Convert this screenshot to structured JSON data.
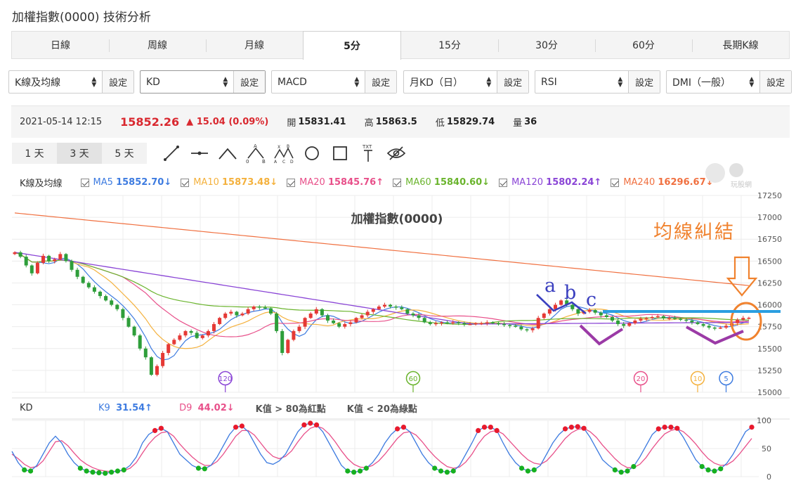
{
  "page": {
    "title": "加權指數(0000) 技術分析"
  },
  "tabs": [
    {
      "label": "日線",
      "active": false
    },
    {
      "label": "周線",
      "active": false
    },
    {
      "label": "月線",
      "active": false
    },
    {
      "label": "5分",
      "active": true
    },
    {
      "label": "15分",
      "active": false
    },
    {
      "label": "30分",
      "active": false
    },
    {
      "label": "60分",
      "active": false
    },
    {
      "label": "長期K線",
      "active": false
    }
  ],
  "selectors": [
    {
      "value": "K線及均線",
      "button": "設定"
    },
    {
      "value": "KD",
      "button": "設定"
    },
    {
      "value": "MACD",
      "button": "設定"
    },
    {
      "value": "月KD（日）",
      "button": "設定"
    },
    {
      "value": "RSI",
      "button": "設定"
    },
    {
      "value": "DMI（一般）",
      "button": "設定"
    }
  ],
  "quote": {
    "datetime": "2021-05-14 12:15",
    "price": "15852.26",
    "change": "▲ 15.04 (0.09%)",
    "open_label": "開",
    "open": "15831.41",
    "high_label": "高",
    "high": "15863.5",
    "low_label": "低",
    "low": "15829.74",
    "volume_label": "量",
    "volume": "36"
  },
  "ranges": [
    {
      "label": "1 天",
      "active": false
    },
    {
      "label": "3 天",
      "active": true
    },
    {
      "label": "5 天",
      "active": false
    }
  ],
  "drawing_tools": [
    "line-tool-icon",
    "horizontal-line-tool-icon",
    "angle-tool-icon",
    "abc-pattern-tool-icon",
    "abcd-pattern-tool-icon",
    "circle-tool-icon",
    "rectangle-tool-icon",
    "text-tool-icon",
    "hide-drawings-icon"
  ],
  "ma_legend": {
    "title": "K線及均線",
    "items": [
      {
        "name": "MA5",
        "value": "15852.70↓",
        "color": "#3d7be0"
      },
      {
        "name": "MA10",
        "value": "15873.48↓",
        "color": "#f4b13d"
      },
      {
        "name": "MA20",
        "value": "15845.76↑",
        "color": "#e8508a"
      },
      {
        "name": "MA60",
        "value": "15840.60↓",
        "color": "#6ab42d"
      },
      {
        "name": "MA120",
        "value": "15802.24↑",
        "color": "#8a45d6"
      },
      {
        "name": "MA240",
        "value": "16296.67↓",
        "color": "#f07040"
      }
    ]
  },
  "watermark": "玩股網",
  "chart_title": "加權指數(0000)",
  "annotations": {
    "text": "均線糾結",
    "letters": [
      "a",
      "b",
      "c"
    ]
  },
  "kd_legend": {
    "title": "KD",
    "k_label": "K9",
    "k_value": "31.54↑",
    "k_color": "#3d7be0",
    "d_label": "D9",
    "d_value": "44.02↓",
    "d_color": "#e8508a",
    "note1": "K值 > 80為紅點",
    "note2": "K值 < 20為綠點"
  },
  "chart_data": [
    {
      "type": "candlestick",
      "title": "加權指數(0000)",
      "y_ticks": [
        15000,
        15250,
        15500,
        15750,
        16000,
        16250,
        16500,
        16750,
        17000,
        17250
      ],
      "ylim": [
        15000,
        17250
      ],
      "grid": true,
      "ma_markers": [
        {
          "label": "120",
          "color": "#8a45d6"
        },
        {
          "label": "60",
          "color": "#6ab42d"
        },
        {
          "label": "20",
          "color": "#e8508a"
        },
        {
          "label": "10",
          "color": "#f4b13d"
        },
        {
          "label": "5",
          "color": "#3d7be0"
        }
      ],
      "closes": [
        16600,
        16550,
        16450,
        16360,
        16480,
        16560,
        16500,
        16520,
        16580,
        16500,
        16400,
        16320,
        16250,
        16200,
        16150,
        16100,
        16050,
        16000,
        15950,
        15850,
        15750,
        15650,
        15500,
        15400,
        15200,
        15300,
        15450,
        15550,
        15600,
        15650,
        15700,
        15680,
        15620,
        15650,
        15700,
        15780,
        15850,
        15900,
        15920,
        15880,
        15900,
        15950,
        15980,
        15970,
        15960,
        15900,
        15700,
        15450,
        15600,
        15700,
        15750,
        15850,
        15900,
        15950,
        15880,
        15820,
        15790,
        15750,
        15780,
        15800,
        15850,
        15880,
        15920,
        15950,
        15980,
        16000,
        15980,
        15970,
        15950,
        15900,
        15880,
        15850,
        15800,
        15780,
        15790,
        15800,
        15790,
        15800,
        15790,
        15780,
        15780,
        15790,
        15790,
        15800,
        15790,
        15780,
        15770,
        15760,
        15750,
        15720,
        15710,
        15730,
        15850,
        15900,
        15950,
        16000,
        16050,
        16000,
        15950,
        15900,
        15920,
        15940,
        15910,
        15880,
        15860,
        15820,
        15780,
        15760,
        15790,
        15820,
        15840,
        15850,
        15860,
        15870,
        15850,
        15850,
        15840,
        15830,
        15820,
        15800,
        15780,
        15760,
        15740,
        15735,
        15740,
        15760,
        15790,
        15830,
        15850,
        15852
      ]
    },
    {
      "type": "line",
      "title": "KD",
      "y_ticks": [
        0,
        50,
        100
      ],
      "ylim": [
        0,
        100
      ],
      "series": [
        {
          "name": "K9",
          "values": [
            45,
            25,
            12,
            10,
            20,
            40,
            60,
            72,
            60,
            40,
            25,
            15,
            10,
            8,
            7,
            6,
            8,
            10,
            12,
            20,
            35,
            60,
            75,
            82,
            86,
            80,
            60,
            40,
            30,
            20,
            15,
            14,
            20,
            35,
            55,
            75,
            88,
            90,
            80,
            60,
            40,
            25,
            22,
            28,
            40,
            60,
            80,
            92,
            95,
            92,
            80,
            60,
            40,
            20,
            10,
            8,
            10,
            15,
            25,
            40,
            60,
            75,
            85,
            88,
            80,
            60,
            40,
            25,
            15,
            10,
            8,
            10,
            20,
            40,
            60,
            82,
            88,
            88,
            82,
            60,
            40,
            25,
            15,
            10,
            12,
            20,
            40,
            60,
            75,
            85,
            88,
            89,
            86,
            70,
            50,
            30,
            20,
            12,
            8,
            10,
            18,
            35,
            55,
            75,
            85,
            88,
            88,
            86,
            70,
            50,
            30,
            18,
            12,
            10,
            14,
            24,
            40,
            60,
            80,
            88
          ]
        },
        {
          "name": "D9",
          "values": [
            40,
            32,
            22,
            16,
            18,
            28,
            45,
            62,
            64,
            55,
            42,
            30,
            22,
            16,
            12,
            10,
            9,
            10,
            11,
            15,
            25,
            42,
            58,
            70,
            78,
            80,
            72,
            58,
            46,
            35,
            26,
            20,
            20,
            27,
            40,
            56,
            72,
            82,
            82,
            74,
            60,
            46,
            36,
            32,
            36,
            46,
            62,
            76,
            86,
            90,
            86,
            76,
            62,
            46,
            32,
            22,
            17,
            16,
            20,
            28,
            40,
            54,
            68,
            78,
            80,
            74,
            62,
            48,
            36,
            26,
            18,
            15,
            17,
            26,
            40,
            58,
            72,
            80,
            82,
            76,
            64,
            52,
            40,
            30,
            24,
            22,
            28,
            40,
            54,
            68,
            78,
            84,
            86,
            80,
            70,
            56,
            44,
            32,
            22,
            16,
            16,
            22,
            34,
            50,
            64,
            76,
            82,
            85,
            80,
            70,
            58,
            44,
            32,
            24,
            20,
            21,
            28,
            40,
            54,
            68
          ]
        }
      ]
    }
  ]
}
